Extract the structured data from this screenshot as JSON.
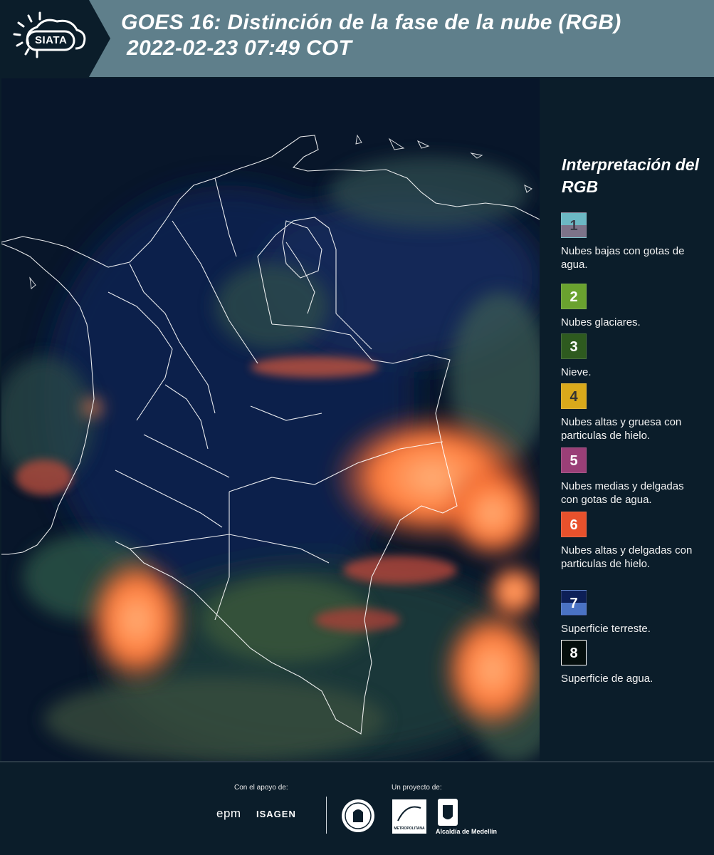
{
  "header": {
    "logo_text": "SIATA",
    "title_line1": "GOES 16: Distinción de la fase de la nube (RGB)",
    "title_line2": "2022-02-23 07:49 COT"
  },
  "legend": {
    "title": "Interpretación del RGB",
    "items": [
      {
        "number": "1",
        "label": "Nubes bajas con gotas de agua.",
        "color_top": "#6cb8c4",
        "color_bottom": "#7d7389",
        "text_color": "#3d3d4a"
      },
      {
        "number": "2",
        "label": "Nubes glaciares.",
        "color": "#6aa22f",
        "text_color": "#ffffff"
      },
      {
        "number": "3",
        "label": "Nieve.",
        "color": "#2e5a1f",
        "text_color": "#ffffff"
      },
      {
        "number": "4",
        "label": "Nubes altas y gruesa con particulas de hielo.",
        "color": "#d9a91b",
        "text_color": "#333333"
      },
      {
        "number": "5",
        "label": "Nubes medias y delgadas con gotas de agua.",
        "color": "#9a3f77",
        "text_color": "#ffffff"
      },
      {
        "number": "6",
        "label": "Nubes altas y delgadas con particulas de hielo.",
        "color": "#e8512c",
        "text_color": "#ffffff"
      },
      {
        "number": "7",
        "label": "Superficie terreste.",
        "color_top": "#0d1f57",
        "color_bottom": "#4a72c4",
        "text_color": "#ffffff"
      },
      {
        "number": "8",
        "label": "Superficie de agua.",
        "color": "#050e0d",
        "text_color": "#ffffff"
      }
    ]
  },
  "footer": {
    "support_label": "Con el apoyo de:",
    "project_label": "Un proyecto de:",
    "sponsor_1": "epm",
    "sponsor_2": "ISAGEN",
    "partner_metro": "METROPOLITANA",
    "partner_alcaldia": "Alcaldía de Medellín"
  },
  "colors": {
    "header_bg": "#5f7f8b",
    "page_bg": "#0b1d2a",
    "cloud_orange": "#f07a3a"
  }
}
